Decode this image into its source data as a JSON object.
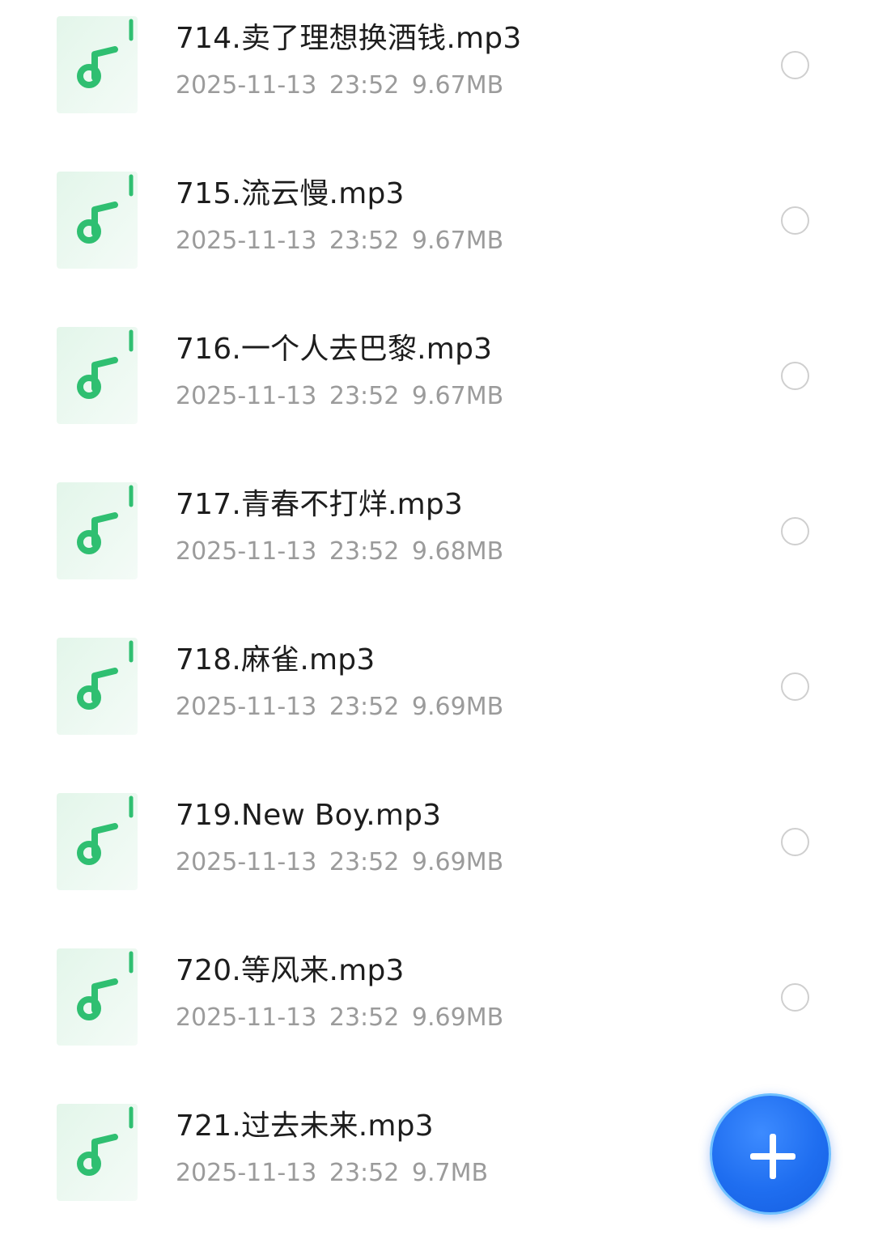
{
  "files": [
    {
      "name": "714.卖了理想换酒钱.mp3",
      "date": "2025-11-13 23:52",
      "size": "9.67MB",
      "icon": "music-note-icon",
      "selected": false
    },
    {
      "name": "715.流云慢.mp3",
      "date": "2025-11-13 23:52",
      "size": "9.67MB",
      "icon": "music-note-icon",
      "selected": false
    },
    {
      "name": "716.一个人去巴黎.mp3",
      "date": "2025-11-13 23:52",
      "size": "9.67MB",
      "icon": "music-note-icon",
      "selected": false
    },
    {
      "name": "717.青春不打烊.mp3",
      "date": "2025-11-13 23:52",
      "size": "9.68MB",
      "icon": "music-note-icon",
      "selected": false
    },
    {
      "name": "718.麻雀.mp3",
      "date": "2025-11-13 23:52",
      "size": "9.69MB",
      "icon": "music-note-icon",
      "selected": false
    },
    {
      "name": "719.New Boy.mp3",
      "date": "2025-11-13 23:52",
      "size": "9.69MB",
      "icon": "music-note-icon",
      "selected": false
    },
    {
      "name": "720.等风来.mp3",
      "date": "2025-11-13 23:52",
      "size": "9.69MB",
      "icon": "music-note-icon",
      "selected": false
    },
    {
      "name": "721.过去未来.mp3",
      "date": "2025-11-13 23:52",
      "size": "9.7MB",
      "icon": "music-note-icon",
      "selected": false
    }
  ],
  "fab": {
    "icon": "plus-icon"
  },
  "colors": {
    "accent_green": "#2fbf71",
    "fab_blue": "#1f6ef0",
    "name_text": "#1d1d1d",
    "meta_text": "#9b9b9b",
    "radio_border": "#cfcfcf"
  }
}
